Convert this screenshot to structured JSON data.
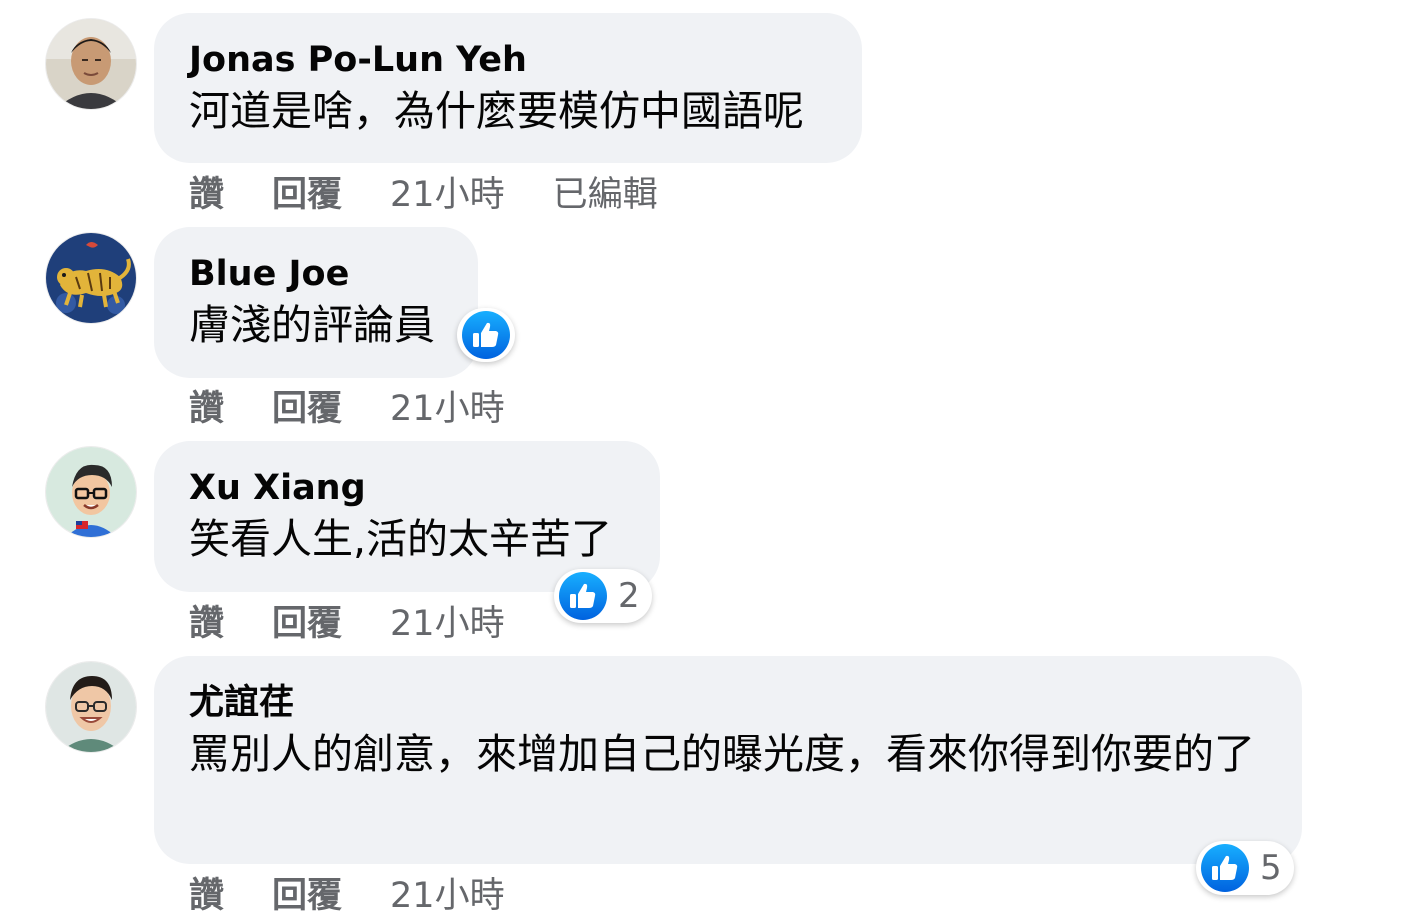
{
  "colors": {
    "bubble_bg": "#f0f2f5",
    "meta_text": "#65676b",
    "like_blue": "#1877f2"
  },
  "comments": [
    {
      "author": "Jonas Po-Lun Yeh",
      "text": "河道是啥，為什麼要模仿中國語呢",
      "like_label": "讚",
      "reply_label": "回覆",
      "time": "21小時",
      "edited": "已編輯",
      "avatar_icon": "profile-photo-icon"
    },
    {
      "author": "Blue Joe",
      "text": "膚淺的評論員",
      "like_label": "讚",
      "reply_label": "回覆",
      "time": "21小時",
      "reaction_icon": "thumbs-up-icon",
      "avatar_icon": "tiger-painting-icon"
    },
    {
      "author": "Xu Xiang",
      "text": "笑看人生,活的太辛苦了",
      "like_label": "讚",
      "reply_label": "回覆",
      "time": "21小時",
      "reaction_icon": "thumbs-up-icon",
      "reaction_count": "2",
      "avatar_icon": "cartoon-avatar-icon"
    },
    {
      "author": "尤誼荏",
      "text": "罵別人的創意，來增加自己的曝光度，看來你得到你要的了",
      "like_label": "讚",
      "reply_label": "回覆",
      "time": "21小時",
      "reaction_icon": "thumbs-up-icon",
      "reaction_count": "5",
      "avatar_icon": "profile-photo-icon"
    }
  ]
}
